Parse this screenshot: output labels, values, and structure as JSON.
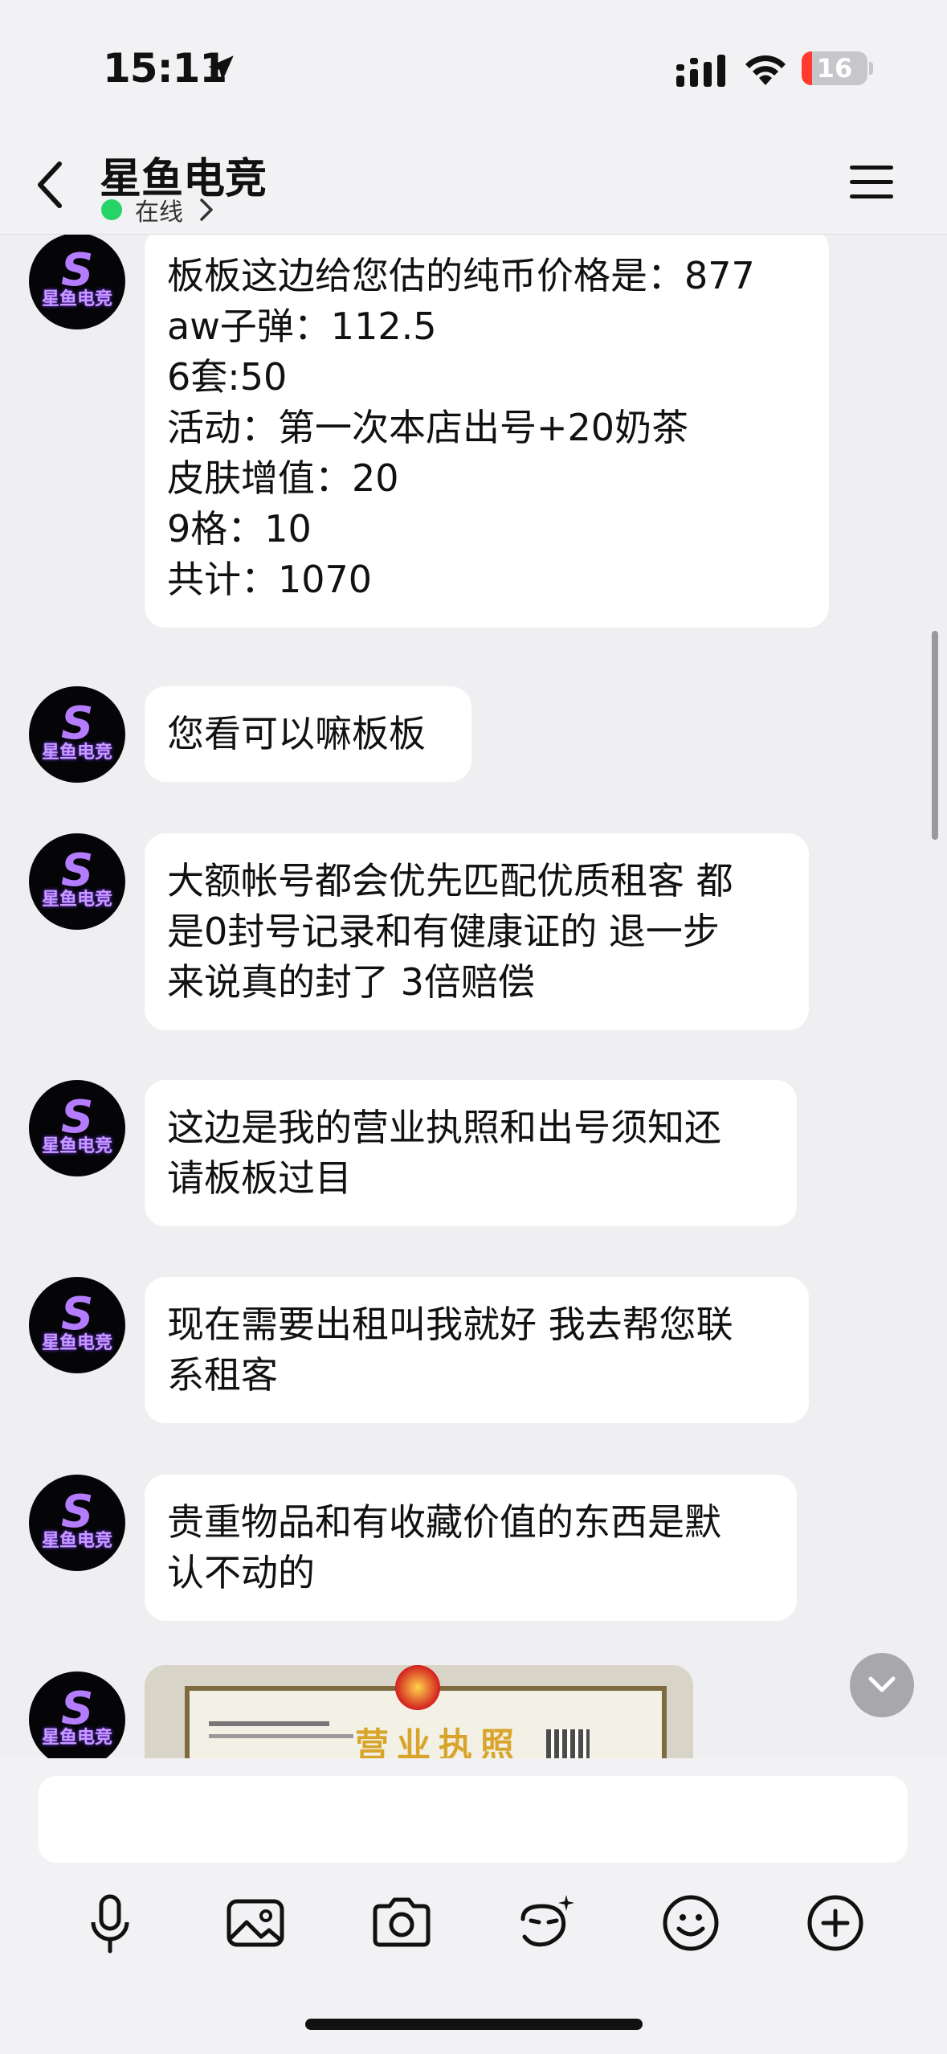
{
  "status_bar": {
    "time": "15:11",
    "battery": "16",
    "icons": [
      "location-arrow-icon",
      "cellular-signal-icon",
      "wifi-icon",
      "battery-icon"
    ]
  },
  "header": {
    "title": "星鱼电竞",
    "status": "在线",
    "icons": [
      "back-chevron-icon",
      "chevron-right-icon",
      "hamburger-menu-icon"
    ]
  },
  "avatar_text": "星鱼电竞",
  "messages": [
    {
      "lines": [
        "板板这边给您估的纯币价格是：877",
        "aw子弹：112.5",
        "6套:50",
        "活动：第一次本店出号+20奶茶",
        "皮肤增值：20",
        "9格：10",
        "共计：1070"
      ]
    },
    {
      "lines": [
        "您看可以嘛板板"
      ]
    },
    {
      "lines": [
        "大额帐号都会优先匹配优质租客 都",
        "是0封号记录和有健康证的 退一步",
        "来说真的封了 3倍赔偿"
      ]
    },
    {
      "lines": [
        "这边是我的营业执照和出号须知还",
        "请板板过目"
      ]
    },
    {
      "lines": [
        "现在需要出租叫我就好 我去帮您联",
        "系租客"
      ]
    },
    {
      "lines": [
        "贵重物品和有收藏价值的东西是默",
        "认不动的"
      ]
    }
  ],
  "image_message": {
    "title": "营业执照",
    "icon": "license-image"
  },
  "composer": {
    "placeholder": "",
    "tools": [
      "microphone-icon",
      "image-icon",
      "camera-icon",
      "sticker-icon",
      "emoji-icon",
      "plus-icon"
    ]
  },
  "colors": {
    "online": "#25d366",
    "battery_low": "#ff3b30",
    "bubble": "#ffffff",
    "background": "#efeff1"
  }
}
